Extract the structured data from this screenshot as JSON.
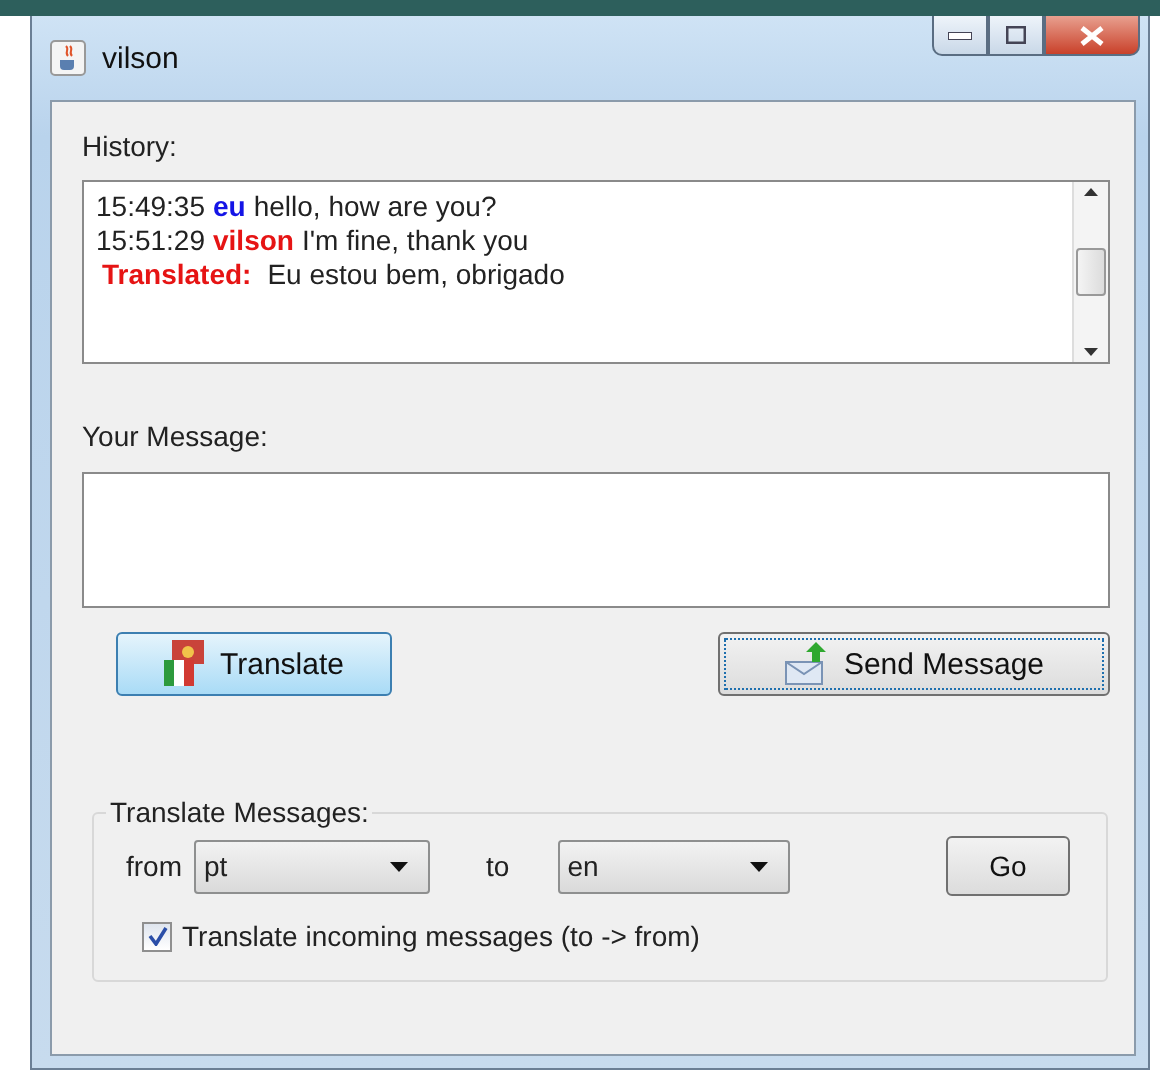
{
  "window": {
    "title": "vilson"
  },
  "history": {
    "label": "History:",
    "lines": [
      {
        "kind": "message",
        "time": "15:49:35",
        "sender": "eu",
        "color": "#1414e6",
        "text": "hello, how are you?"
      },
      {
        "kind": "message",
        "time": "15:51:29",
        "sender": "vilson",
        "color": "#e61414",
        "text": "I'm fine, thank you"
      },
      {
        "kind": "translation",
        "label": "Translated:",
        "text": "Eu estou bem, obrigado"
      }
    ]
  },
  "message": {
    "label": "Your Message:"
  },
  "buttons": [
    {
      "kind": "translate",
      "label": "Translate",
      "highlighted": true,
      "focused": false
    },
    {
      "kind": "send",
      "label": "Send Message",
      "highlighted": false,
      "focused": true
    }
  ],
  "translate_group": {
    "title": "Translate Messages:",
    "from_label": "from",
    "from_value": "pt",
    "to_label": "to",
    "to_value": "en",
    "go": "Go",
    "incoming": {
      "label": "Translate incoming messages (to -> from)",
      "checked": true
    }
  }
}
